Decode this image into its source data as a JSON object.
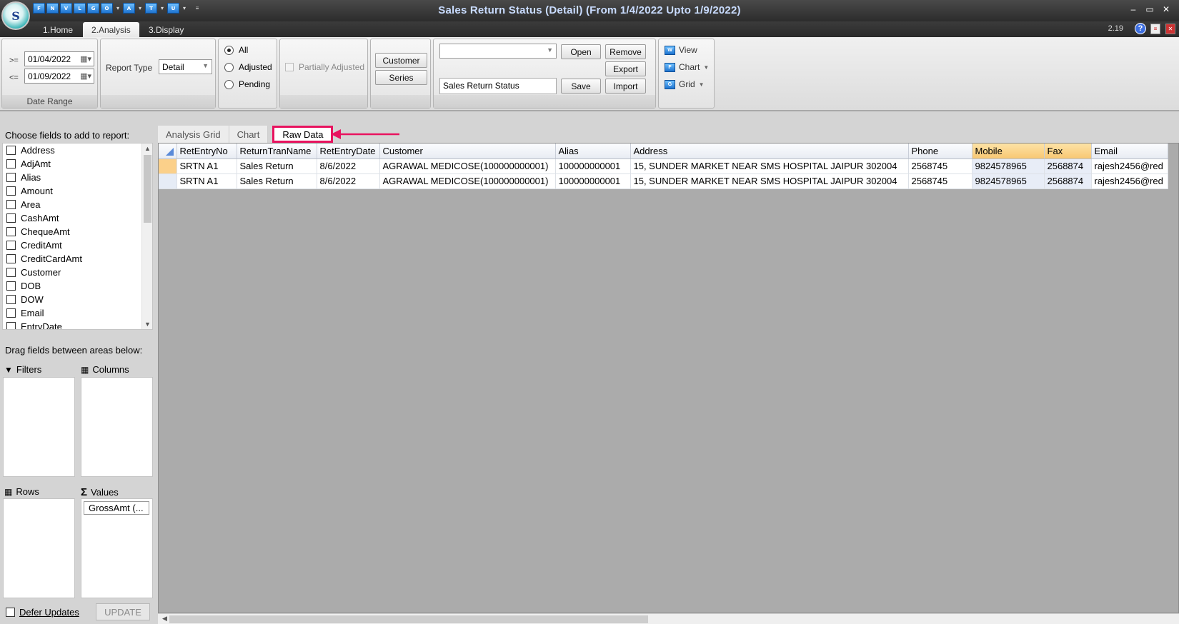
{
  "window": {
    "title": "Sales Return Status (Detail)  (From 1/4/2022 Upto 1/9/2022)",
    "version": "2.19",
    "logo_letter": "S"
  },
  "qat": {
    "buttons": [
      "F",
      "N",
      "V",
      "L",
      "G",
      "O",
      "A",
      "T",
      "U"
    ]
  },
  "ribbon_tabs": [
    {
      "label": "1.Home"
    },
    {
      "label": "2.Analysis"
    },
    {
      "label": "3.Display"
    }
  ],
  "date_range": {
    "label": "Date Range",
    "from_op": ">=",
    "from_value": "01/04/2022",
    "to_op": "<=",
    "to_value": "01/09/2022"
  },
  "report_type": {
    "label": "Report Type",
    "value": "Detail"
  },
  "status_filter": {
    "options": [
      "All",
      "Adjusted",
      "Pending"
    ],
    "selected": "All"
  },
  "partial": {
    "label": "Partially Adjusted"
  },
  "group_buttons": {
    "customer": "Customer",
    "series": "Series"
  },
  "layout": {
    "combo_value": "",
    "name_value": "Sales Return Status",
    "open": "Open",
    "remove": "Remove",
    "export": "Export",
    "save": "Save",
    "import": "Import"
  },
  "view_group": {
    "view": "View",
    "chart": "Chart",
    "grid": "Grid"
  },
  "field_chooser": {
    "title": "Choose fields to add to report:",
    "fields": [
      "Address",
      "AdjAmt",
      "Alias",
      "Amount",
      "Area",
      "CashAmt",
      "ChequeAmt",
      "CreditAmt",
      "CreditCardAmt",
      "Customer",
      "DOB",
      "DOW",
      "Email",
      "EntryDate"
    ],
    "drag_label": "Drag fields between areas below:",
    "filters": "Filters",
    "columns": "Columns",
    "rows": "Rows",
    "values": "Values",
    "values_items": [
      "GrossAmt (..."
    ],
    "defer": "Defer Updates",
    "update": "UPDATE"
  },
  "content_tabs": [
    {
      "label": "Analysis Grid"
    },
    {
      "label": "Chart"
    },
    {
      "label": "Raw Data"
    }
  ],
  "grid": {
    "columns": [
      "RetEntryNo",
      "ReturnTranName",
      "RetEntryDate",
      "Customer",
      "Alias",
      "Address",
      "Phone",
      "Mobile",
      "Fax",
      "Email"
    ],
    "rows": [
      [
        "SRTN A1",
        "Sales Return",
        "8/6/2022",
        "AGRAWAL MEDICOSE(100000000001)",
        "100000000001",
        "15, SUNDER MARKET NEAR SMS HOSPITAL JAIPUR 302004",
        "2568745",
        "9824578965",
        "2568874",
        "rajesh2456@red"
      ],
      [
        "SRTN A1",
        "Sales Return",
        "8/6/2022",
        "AGRAWAL MEDICOSE(100000000001)",
        "100000000001",
        "15, SUNDER MARKET NEAR SMS HOSPITAL JAIPUR 302004",
        "2568745",
        "9824578965",
        "2568874",
        "rajesh2456@red"
      ]
    ]
  },
  "colors": {
    "highlight_border": "#e8135f",
    "title_text": "#c9dcff",
    "selected_row": "#fbd08a",
    "highlight_header": "#f8c773"
  }
}
